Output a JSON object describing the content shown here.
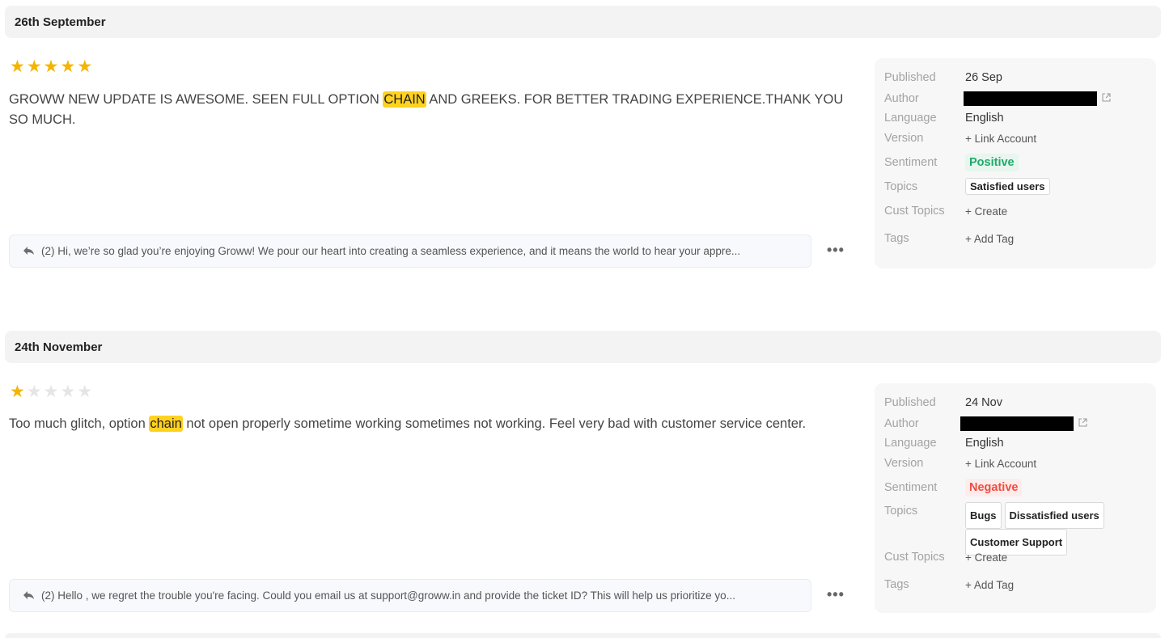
{
  "reviews": [
    {
      "date": "26th September",
      "rating": 5,
      "text_before": "GROWW NEW UPDATE IS AWESOME. SEEN FULL OPTION ",
      "highlight": "CHAIN",
      "text_after": " AND GREEKS. FOR BETTER TRADING EXPERIENCE.THANK YOU SO MUCH.",
      "reply": "(2) Hi, we’re so glad you’re enjoying Groww! We pour our heart into creating a seamless experience, and it means the world to hear your appre...",
      "meta": {
        "published_label": "Published",
        "published": "26 Sep",
        "author_label": "Author",
        "language_label": "Language",
        "language": "English",
        "version_label": "Version",
        "version_action": "+ Link Account",
        "sentiment_label": "Sentiment",
        "sentiment": "Positive",
        "topics_label": "Topics",
        "topics": [
          "Satisfied users"
        ],
        "cust_topics_label": "Cust Topics",
        "cust_topics_action": "+ Create",
        "tags_label": "Tags",
        "tags_action": "+ Add Tag"
      }
    },
    {
      "date": "24th November",
      "rating": 1,
      "text_before": "Too much glitch, option ",
      "highlight": "chain",
      "text_after": " not open properly sometime working sometimes not working. Feel very bad with customer service center.",
      "reply": "(2) Hello , we regret the trouble you're facing. Could you email us at support@groww.in and provide the ticket ID? This will help us prioritize yo...",
      "meta": {
        "published_label": "Published",
        "published": "24 Nov",
        "author_label": "Author",
        "language_label": "Language",
        "language": "English",
        "version_label": "Version",
        "version_action": "+ Link Account",
        "sentiment_label": "Sentiment",
        "sentiment": "Negative",
        "topics_label": "Topics",
        "topics": [
          "Bugs",
          "Dissatisfied users",
          "Customer Support"
        ],
        "cust_topics_label": "Cust Topics",
        "cust_topics_action": "+ Create",
        "tags_label": "Tags",
        "tags_action": "+ Add Tag"
      }
    }
  ],
  "icons": {
    "star": "★",
    "reply": "reply-arrow-icon",
    "more": "•••",
    "external_link": "external-link-icon"
  },
  "colors": {
    "star_on": "#f5b400",
    "highlight": "#ffd21f",
    "positive": "#21a86a",
    "negative": "#ef4d3f"
  }
}
